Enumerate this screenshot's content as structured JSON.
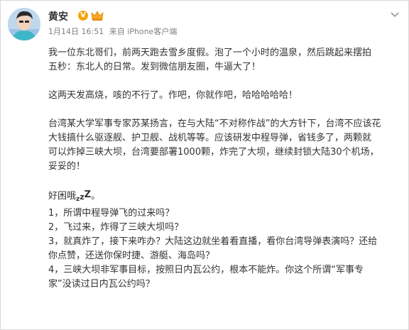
{
  "post": {
    "author": "黄安",
    "verified_icon": "verified-v-icon",
    "vip_icon": "crown-icon",
    "timestamp": "1月14日 16:51",
    "source": "来自 iPhone客户端",
    "more_icon": "chevron-down-icon",
    "paragraphs": [
      [
        "我一位东北哥们，前两天跑去雪乡度假。泡了一个小时的温泉，然后跳起来摆拍",
        "五秒：东北人的日常。发到微信朋友圈，牛逼大了！"
      ],
      [
        "这两天发高烧，咳的不行了。作吧，你就作吧，哈哈哈哈哈！"
      ],
      [
        "台湾某大学军事专家苏某扬言，在与大陆“不对称作战”的大方针下，台湾不应该花",
        "大钱搞什么驱逐舰、护卫舰、战机等等。应该研发中程导弹，省钱多了，两颗就",
        "可以炸掉三峡大坝，台湾要部署1000颗，炸完了大坝，继续封锁大陆30个机场，",
        "妥妥的！"
      ]
    ],
    "closing": {
      "intro": "好困哦",
      "zzz": [
        "z",
        "z",
        "Z"
      ],
      "end_mark": "。",
      "lines": [
        "1，所谓中程导弹飞的过来吗？",
        "2，飞过来，炸得了三峡大坝吗？",
        "3，就真炸了，接下来咋办？大陆这边就坐着看直播，看你台湾导弹表演吗？还给",
        "你点赞，还送你保时捷、游艇、海岛吗？",
        "4，三峡大坝非军事目标，按照日内瓦公约，根本不能炸。你这个所谓“军事专",
        "家”没读过日内瓦公约吗？"
      ]
    }
  }
}
